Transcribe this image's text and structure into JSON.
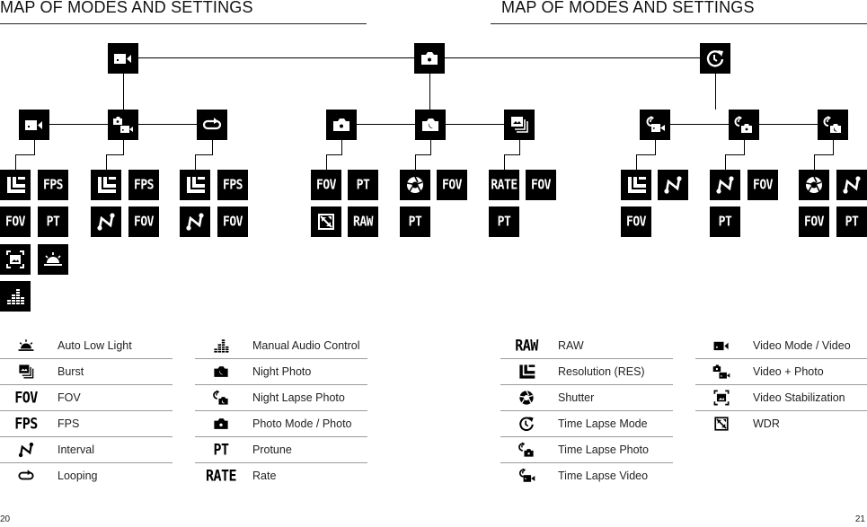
{
  "pages": {
    "left": {
      "title": "MAP OF MODES AND SETTINGS",
      "page_number": "20"
    },
    "right": {
      "title": "MAP OF MODES AND SETTINGS",
      "page_number": "21"
    }
  },
  "tree": {
    "modes": [
      {
        "name": "video",
        "icon": "video-icon",
        "submodes": [
          {
            "name": "video",
            "icon": "video-icon",
            "settings": [
              "resolution-icon",
              "FPS",
              "FOV",
              "PT",
              "stabilization-icon",
              "low-light-icon",
              "audio-icon"
            ]
          },
          {
            "name": "video-photo",
            "icon": "video-photo-icon",
            "settings": [
              "resolution-icon",
              "FPS",
              "interval-icon",
              "FOV"
            ]
          },
          {
            "name": "looping",
            "icon": "looping-icon",
            "settings": [
              "resolution-icon",
              "FPS",
              "interval-icon",
              "FOV"
            ]
          }
        ]
      },
      {
        "name": "photo",
        "icon": "photo-icon",
        "submodes": [
          {
            "name": "photo",
            "icon": "photo-icon",
            "settings": [
              "FOV",
              "PT",
              "wdr-icon",
              "RAW"
            ]
          },
          {
            "name": "night-photo",
            "icon": "night-photo-icon",
            "settings": [
              "shutter-icon",
              "FOV",
              "PT"
            ]
          },
          {
            "name": "burst",
            "icon": "burst-icon",
            "settings": [
              "RATE",
              "FOV",
              "PT"
            ]
          }
        ]
      },
      {
        "name": "time-lapse",
        "icon": "time-lapse-icon",
        "submodes": [
          {
            "name": "time-lapse-video",
            "icon": "time-lapse-video-icon",
            "settings": [
              "resolution-icon",
              "interval-icon",
              "FOV"
            ]
          },
          {
            "name": "time-lapse-photo",
            "icon": "time-lapse-photo-icon",
            "settings": [
              "interval-icon",
              "FOV",
              "PT"
            ]
          },
          {
            "name": "night-lapse-photo",
            "icon": "night-lapse-icon",
            "settings": [
              "shutter-icon",
              "interval-icon",
              "FOV",
              "PT"
            ]
          }
        ]
      }
    ]
  },
  "legend": {
    "col1": [
      {
        "icon": "low-light-icon",
        "label": "Auto Low Light"
      },
      {
        "icon": "burst-icon",
        "label": "Burst"
      },
      {
        "icon": "FOV",
        "label": "FOV"
      },
      {
        "icon": "FPS",
        "label": "FPS"
      },
      {
        "icon": "interval-icon",
        "label": "Interval"
      },
      {
        "icon": "looping-icon",
        "label": "Looping"
      }
    ],
    "col2": [
      {
        "icon": "audio-icon",
        "label": "Manual Audio Control"
      },
      {
        "icon": "night-photo-icon",
        "label": "Night Photo"
      },
      {
        "icon": "night-lapse-icon",
        "label": "Night Lapse Photo"
      },
      {
        "icon": "photo-icon",
        "label": "Photo Mode / Photo"
      },
      {
        "icon": "PT",
        "label": "Protune"
      },
      {
        "icon": "RATE",
        "label": "Rate"
      }
    ],
    "col3": [
      {
        "icon": "RAW",
        "label": "RAW"
      },
      {
        "icon": "resolution-icon",
        "label": "Resolution (RES)"
      },
      {
        "icon": "shutter-icon",
        "label": "Shutter"
      },
      {
        "icon": "time-lapse-icon",
        "label": "Time Lapse Mode"
      },
      {
        "icon": "time-lapse-photo-icon",
        "label": "Time Lapse Photo"
      },
      {
        "icon": "time-lapse-video-icon",
        "label": "Time Lapse Video"
      }
    ],
    "col4": [
      {
        "icon": "video-icon",
        "label": "Video Mode / Video"
      },
      {
        "icon": "video-photo-icon",
        "label": "Video + Photo"
      },
      {
        "icon": "stabilization-icon",
        "label": "Video Stabilization"
      },
      {
        "icon": "wdr-icon",
        "label": "WDR"
      }
    ]
  }
}
